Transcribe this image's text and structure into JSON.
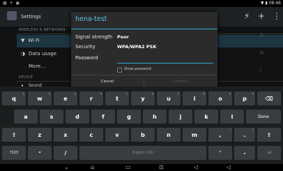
{
  "status_bar": {
    "left_icons": "▦ ✈ ▣",
    "right_text": "▼ ▮ 08:46"
  },
  "action_bar": {
    "title": "Settings",
    "icons": [
      "⚡",
      "+",
      "⋮"
    ]
  },
  "settings": {
    "section_wireless": "WIRELESS & NETWORKS",
    "wifi_label": "Wi-Fi",
    "data_usage_label": "Data usage",
    "more_label": "More...",
    "section_device": "DEVICE",
    "sound_label": "Sound"
  },
  "dialog": {
    "title": "hena-test",
    "signal_label": "Signal strength",
    "signal_value": "Poor",
    "security_label": "Security",
    "security_value": "WPA/WPA2 PSK",
    "password_label": "Password",
    "password_value": "",
    "show_password_label": "Show password",
    "cancel_label": "Cancel",
    "connect_label": "Connect"
  },
  "keyboard": {
    "row1": [
      "q",
      "w",
      "e",
      "r",
      "t",
      "y",
      "u",
      "i",
      "o",
      "p"
    ],
    "row1_hints": [
      "1",
      "2",
      "3",
      "4",
      "5",
      "6",
      "7",
      "8",
      "9",
      "0"
    ],
    "row2": [
      "a",
      "s",
      "d",
      "f",
      "g",
      "h",
      "j",
      "k",
      "l"
    ],
    "row3": [
      "z",
      "x",
      "c",
      "v",
      "b",
      "n",
      "m",
      ",",
      "."
    ],
    "row3_hints": [
      "",
      "",
      "",
      "",
      "",
      "",
      "",
      "!",
      "?"
    ],
    "backspace": "⌫",
    "done": "Done",
    "shift": "⇧",
    "symbols": "?123",
    "settings_key": "⌗",
    "slash": "/",
    "space": "English (US)",
    "apostrophe": "'",
    "dash": "-",
    "smiley": ":-)"
  },
  "nav_bar": {
    "icons": [
      "⌄",
      "⌂",
      "▭",
      "⊡",
      "◁",
      "◁"
    ]
  }
}
